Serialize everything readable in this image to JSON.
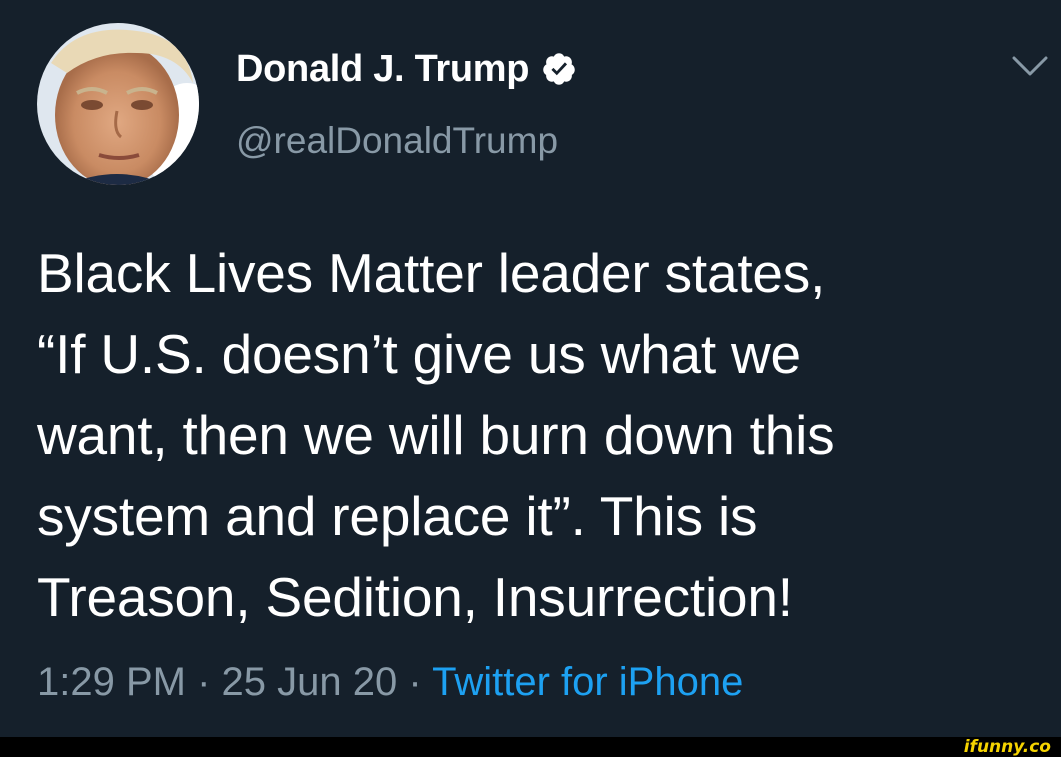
{
  "author": {
    "display_name": "Donald J. Trump",
    "handle": "@realDonaldTrump",
    "verified": true
  },
  "icons": {
    "verified": "verified-badge-icon",
    "menu": "chevron-down-icon"
  },
  "tweet": {
    "text": "Black Lives Matter leader states,\n“If U.S. doesn’t give us what we\nwant, then we will burn down this\nsystem and replace it”. This is\nTreason, Sedition, Insurrection!",
    "time": "1:29 PM",
    "separator": "·",
    "date": "25 Jun 20",
    "source": "Twitter for iPhone"
  },
  "watermark": "ifunny.co",
  "colors": {
    "background": "#15202b",
    "text_primary": "#ffffff",
    "text_secondary": "#8899a6",
    "link": "#1da1f2",
    "watermark": "#f5d300"
  }
}
